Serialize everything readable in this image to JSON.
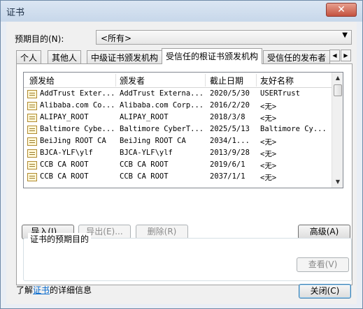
{
  "window": {
    "title": "证书",
    "close_glyph": "✕"
  },
  "purpose": {
    "label": "预期目的(N):",
    "selected": "<所有>",
    "arrow": "▼"
  },
  "tabs": [
    {
      "label": "个人",
      "active": false
    },
    {
      "label": "其他人",
      "active": false
    },
    {
      "label": "中级证书颁发机构",
      "active": false
    },
    {
      "label": "受信任的根证书颁发机构",
      "active": true
    },
    {
      "label": "受信任的发布者",
      "active": false
    }
  ],
  "tab_scroll": {
    "left": "◀",
    "right": "▶"
  },
  "list": {
    "headers": [
      "颁发给",
      "颁发者",
      "截止日期",
      "友好名称"
    ],
    "rows": [
      {
        "issued_to": "AddTrust Exter...",
        "issuer": "AddTrust Externa...",
        "expires": "2020/5/30",
        "friendly": "USERTrust"
      },
      {
        "issued_to": "Alibaba.com Co...",
        "issuer": "Alibaba.com Corp...",
        "expires": "2016/2/20",
        "friendly": "<无>"
      },
      {
        "issued_to": "ALIPAY_ROOT",
        "issuer": "ALIPAY_ROOT",
        "expires": "2018/3/8",
        "friendly": "<无>"
      },
      {
        "issued_to": "Baltimore Cybe...",
        "issuer": "Baltimore CyberT...",
        "expires": "2025/5/13",
        "friendly": "Baltimore Cy..."
      },
      {
        "issued_to": "BeiJing ROOT CA",
        "issuer": "BeiJing ROOT CA",
        "expires": "2034/1...",
        "friendly": "<无>"
      },
      {
        "issued_to": "BJCA-YLF\\ylf",
        "issuer": "BJCA-YLF\\ylf",
        "expires": "2013/9/28",
        "friendly": "<无>"
      },
      {
        "issued_to": "CCB CA ROOT",
        "issuer": "CCB CA ROOT",
        "expires": "2019/6/1",
        "friendly": "<无>"
      },
      {
        "issued_to": "CCB CA ROOT",
        "issuer": "CCB CA ROOT",
        "expires": "2037/1/1",
        "friendly": "<无>"
      }
    ],
    "scroll_up": "▲",
    "scroll_down": "▼"
  },
  "buttons": {
    "import": "导入(I)...",
    "export": "导出(E)...",
    "remove": "删除(R)",
    "advanced": "高级(A)",
    "view": "查看(V)",
    "close": "关闭(C)"
  },
  "purposes_group": {
    "legend": "证书的预期目的"
  },
  "footer": {
    "prefix": "了解",
    "link": "证书",
    "suffix": "的详细信息"
  }
}
